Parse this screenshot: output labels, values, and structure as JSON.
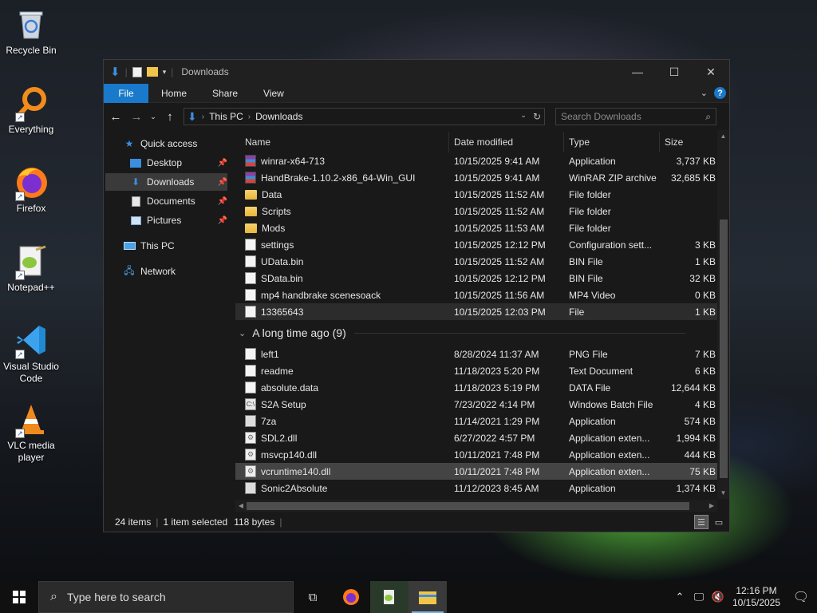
{
  "desktop_icons": [
    {
      "id": "recycle-bin",
      "label": "Recycle Bin",
      "icon": "recycle-bin-icon"
    },
    {
      "id": "everything",
      "label": "Everything",
      "icon": "magnifier-icon"
    },
    {
      "id": "firefox",
      "label": "Firefox",
      "icon": "firefox-icon"
    },
    {
      "id": "notepadpp",
      "label": "Notepad++",
      "icon": "notepad-icon"
    },
    {
      "id": "vscode",
      "label": "Visual Studio Code",
      "icon": "vscode-icon"
    },
    {
      "id": "vlc",
      "label": "VLC media player",
      "icon": "vlc-cone-icon"
    }
  ],
  "window": {
    "title": "Downloads",
    "controls": {
      "minimize": "—",
      "maximize": "☐",
      "close": "✕"
    }
  },
  "ribbon": {
    "tabs": [
      "File",
      "Home",
      "Share",
      "View"
    ],
    "help": "?"
  },
  "address": {
    "crumbs": [
      "This PC",
      "Downloads"
    ],
    "search_placeholder": "Search Downloads"
  },
  "nav": {
    "quick_access": "Quick access",
    "items": [
      {
        "label": "Desktop",
        "pinned": true
      },
      {
        "label": "Downloads",
        "pinned": true,
        "selected": true
      },
      {
        "label": "Documents",
        "pinned": true
      },
      {
        "label": "Pictures",
        "pinned": true
      }
    ],
    "this_pc": "This PC",
    "network": "Network"
  },
  "columns": {
    "name": "Name",
    "date": "Date modified",
    "type": "Type",
    "size": "Size"
  },
  "files_recent": [
    {
      "name": "winrar-x64-713",
      "date": "10/15/2025 9:41 AM",
      "type": "Application",
      "size": "3,737 KB",
      "icon": "rar"
    },
    {
      "name": "HandBrake-1.10.2-x86_64-Win_GUI",
      "date": "10/15/2025 9:41 AM",
      "type": "WinRAR ZIP archive",
      "size": "32,685 KB",
      "icon": "rar"
    },
    {
      "name": "Data",
      "date": "10/15/2025 11:52 AM",
      "type": "File folder",
      "size": "",
      "icon": "folder"
    },
    {
      "name": "Scripts",
      "date": "10/15/2025 11:52 AM",
      "type": "File folder",
      "size": "",
      "icon": "folder"
    },
    {
      "name": "Mods",
      "date": "10/15/2025 11:53 AM",
      "type": "File folder",
      "size": "",
      "icon": "folder"
    },
    {
      "name": "settings",
      "date": "10/15/2025 12:12 PM",
      "type": "Configuration sett...",
      "size": "3 KB",
      "icon": "cfg"
    },
    {
      "name": "UData.bin",
      "date": "10/15/2025 11:52 AM",
      "type": "BIN File",
      "size": "1 KB",
      "icon": "doc"
    },
    {
      "name": "SData.bin",
      "date": "10/15/2025 12:12 PM",
      "type": "BIN File",
      "size": "32 KB",
      "icon": "doc"
    },
    {
      "name": "mp4 handbrake scenesoack",
      "date": "10/15/2025 11:56 AM",
      "type": "MP4 Video",
      "size": "0 KB",
      "icon": "video"
    },
    {
      "name": "13365643",
      "date": "10/15/2025 12:03 PM",
      "type": "File",
      "size": "1 KB",
      "icon": "doc",
      "hover": true
    }
  ],
  "group_old": {
    "label": "A long time ago (9)"
  },
  "files_old": [
    {
      "name": "left1",
      "date": "8/28/2024 11:37 AM",
      "type": "PNG File",
      "size": "7 KB",
      "icon": "doc"
    },
    {
      "name": "readme",
      "date": "11/18/2023 5:20 PM",
      "type": "Text Document",
      "size": "6 KB",
      "icon": "doc"
    },
    {
      "name": "absolute.data",
      "date": "11/18/2023 5:19 PM",
      "type": "DATA File",
      "size": "12,644 KB",
      "icon": "doc"
    },
    {
      "name": "S2A Setup",
      "date": "7/23/2022 4:14 PM",
      "type": "Windows Batch File",
      "size": "4 KB",
      "icon": "cmd"
    },
    {
      "name": "7za",
      "date": "11/14/2021 1:29 PM",
      "type": "Application",
      "size": "574 KB",
      "icon": "app"
    },
    {
      "name": "SDL2.dll",
      "date": "6/27/2022 4:57 PM",
      "type": "Application exten...",
      "size": "1,994 KB",
      "icon": "dll"
    },
    {
      "name": "msvcp140.dll",
      "date": "10/11/2021 7:48 PM",
      "type": "Application exten...",
      "size": "444 KB",
      "icon": "dll"
    },
    {
      "name": "vcruntime140.dll",
      "date": "10/11/2021 7:48 PM",
      "type": "Application exten...",
      "size": "75 KB",
      "icon": "dll",
      "selected": true
    },
    {
      "name": "Sonic2Absolute",
      "date": "11/12/2023 8:45 AM",
      "type": "Application",
      "size": "1,374 KB",
      "icon": "app"
    }
  ],
  "status": {
    "items": "24 items",
    "selected": "1 item selected",
    "bytes": "118 bytes"
  },
  "taskbar": {
    "search_placeholder": "Type here to search",
    "time": "12:16 PM",
    "date": "10/15/2025"
  },
  "colors": {
    "accent": "#1979ca",
    "window_bg": "#191919",
    "selection": "#444444"
  }
}
